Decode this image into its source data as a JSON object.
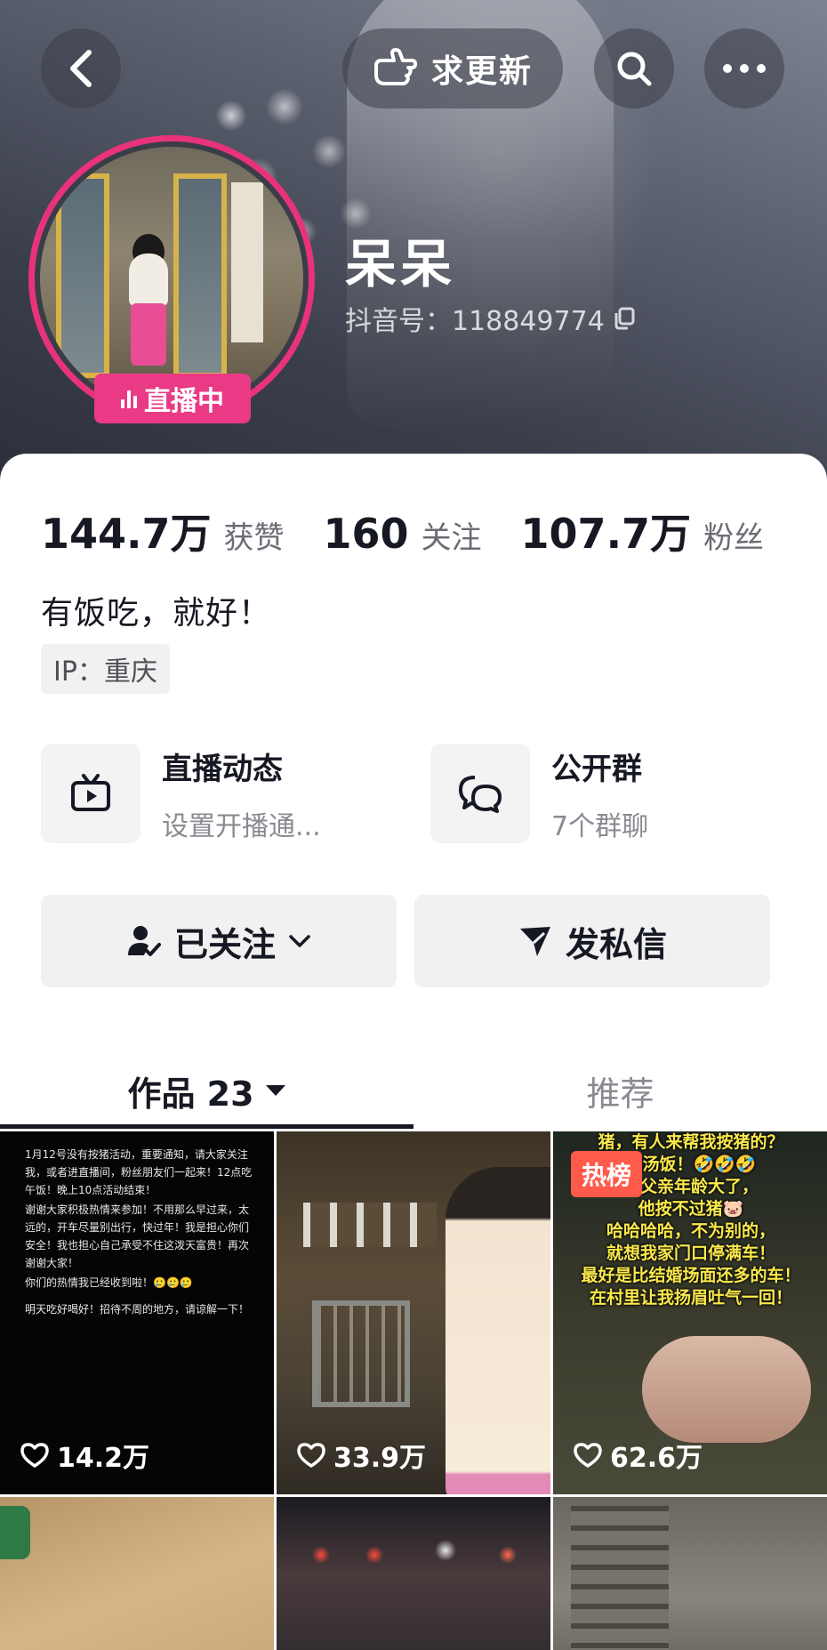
{
  "header": {
    "update_label": "求更新",
    "nickname": "呆呆",
    "douyin_id": "抖音号：118849774",
    "live_badge": "直播中"
  },
  "stats": {
    "likes_num": "144.7万",
    "likes_label": "获赞",
    "following_num": "160",
    "following_label": "关注",
    "followers_num": "107.7万",
    "followers_label": "粉丝"
  },
  "bio": "有饭吃，就好！",
  "ip": "IP：重庆",
  "features": {
    "live": {
      "title": "直播动态",
      "subtitle": "设置开播通..."
    },
    "group": {
      "title": "公开群",
      "subtitle": "7个群聊"
    }
  },
  "actions": {
    "follow_label": "已关注",
    "message_label": "发私信"
  },
  "tabs": {
    "works": "作品 23",
    "recommend": "推荐"
  },
  "videos": [
    {
      "likes": "14.2万",
      "note_lines": [
        "1月12号没有按猪活动，重要通知，请大家关注我，或者进直播间，粉丝朋友们一起来！12点吃午饭！晚上10点活动结束！",
        "谢谢大家积极热情来参加！不用那么早过来，太远的，开车尽量别出行，快过年！我是担心你们安全！我也担心自己承受不住这泼天富贵！再次谢谢大家！",
        "你们的热情我已经收到啦！🥲🥲🥲",
        "明天吃好喝好！招待不周的地方，请谅解一下！"
      ]
    },
    {
      "likes": "33.9万"
    },
    {
      "likes": "62.6万",
      "hot_label": "热榜",
      "caption_lines": [
        "猪，有人来帮我按猪的？",
        "泡汤饭！🤣🤣🤣",
        "老父亲年龄大了，",
        "他按不过猪🐷",
        "哈哈哈哈，不为别的，",
        "就想我家门口停满车！",
        "最好是比结婚场面还多的车！",
        "在村里让我扬眉吐气一回！"
      ]
    },
    {},
    {},
    {}
  ],
  "colors": {
    "live_pink": "#ea3a86",
    "hot_red": "#ff5a4a",
    "caption_yellow": "#fbe94a",
    "text_primary": "#161823",
    "text_secondary": "#8a8b92"
  }
}
